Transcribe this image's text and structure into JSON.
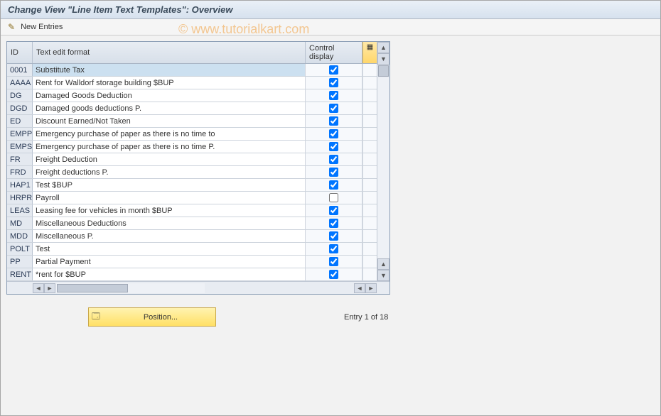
{
  "title": "Change View \"Line Item Text Templates\": Overview",
  "toolbar": {
    "new_entries": "New Entries"
  },
  "columns": {
    "id": "ID",
    "text": "Text edit format",
    "ctrl": "Control display"
  },
  "rows": [
    {
      "id": "0001",
      "text": "Substitute Tax",
      "ctrl": true,
      "selected": true
    },
    {
      "id": "AAAA",
      "text": "Rent for Walldorf storage building $BUP",
      "ctrl": true
    },
    {
      "id": "DG",
      "text": "Damaged Goods Deduction",
      "ctrl": true
    },
    {
      "id": "DGD",
      "text": "Damaged goods deductions P.",
      "ctrl": true
    },
    {
      "id": "ED",
      "text": "Discount Earned/Not Taken",
      "ctrl": true
    },
    {
      "id": "EMPP",
      "text": "Emergency purchase of paper as there is no time to",
      "ctrl": true
    },
    {
      "id": "EMPS",
      "text": "Emergency purchase of paper as there is no time P.",
      "ctrl": true
    },
    {
      "id": "FR",
      "text": "Freight Deduction",
      "ctrl": true
    },
    {
      "id": "FRD",
      "text": "Freight deductions P.",
      "ctrl": true
    },
    {
      "id": "HAP1",
      "text": "Test $BUP",
      "ctrl": true
    },
    {
      "id": "HRPR",
      "text": "Payroll",
      "ctrl": false
    },
    {
      "id": "LEAS",
      "text": "Leasing fee for vehicles in month $BUP",
      "ctrl": true
    },
    {
      "id": "MD",
      "text": "Miscellaneous Deductions",
      "ctrl": true
    },
    {
      "id": "MDD",
      "text": "Miscellaneous P.",
      "ctrl": true
    },
    {
      "id": "POLT",
      "text": "Test",
      "ctrl": true
    },
    {
      "id": "PP",
      "text": "Partial Payment",
      "ctrl": true
    },
    {
      "id": "RENT",
      "text": "*rent for $BUP",
      "ctrl": true
    }
  ],
  "position_btn": "Position...",
  "entry_info": "Entry 1 of 18",
  "watermark": "© www.tutorialkart.com"
}
